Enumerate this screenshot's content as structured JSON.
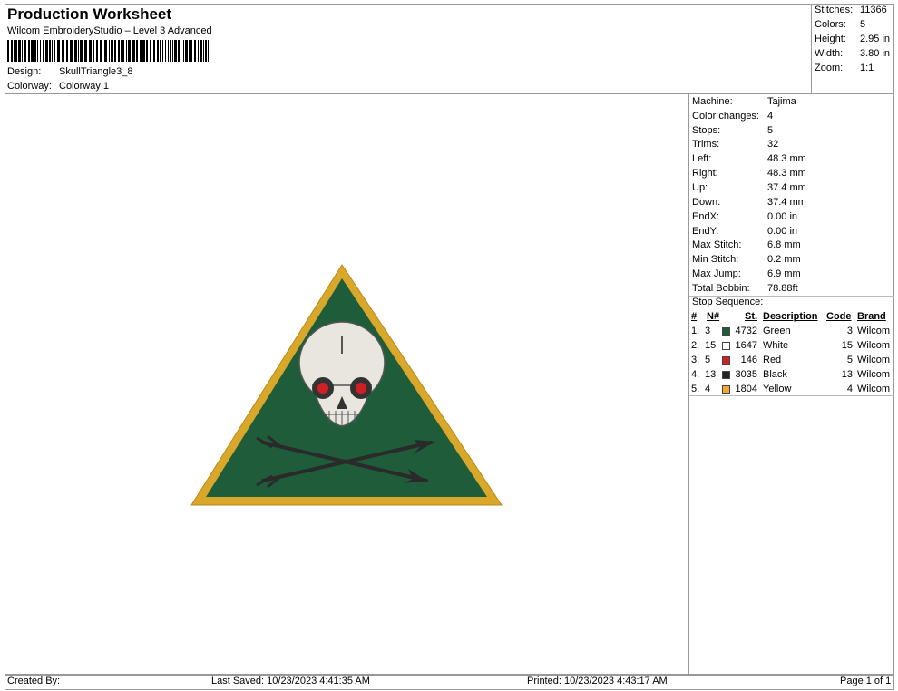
{
  "header": {
    "title": "Production Worksheet",
    "subtitle": "Wilcom EmbroideryStudio – Level 3 Advanced",
    "design_label": "Design:",
    "design_value": "SkullTriangle3_8",
    "colorway_label": "Colorway:",
    "colorway_value": "Colorway 1"
  },
  "stats": [
    {
      "label": "Stitches:",
      "value": "11366"
    },
    {
      "label": "Colors:",
      "value": "5"
    },
    {
      "label": "Height:",
      "value": "2.95 in"
    },
    {
      "label": "Width:",
      "value": "3.80 in"
    },
    {
      "label": "Zoom:",
      "value": "1:1"
    }
  ],
  "properties": [
    {
      "label": "Machine:",
      "value": "Tajima"
    },
    {
      "label": "Color changes:",
      "value": "4"
    },
    {
      "label": "Stops:",
      "value": "5"
    },
    {
      "label": "Trims:",
      "value": "32"
    },
    {
      "label": "Left:",
      "value": "48.3 mm"
    },
    {
      "label": "Right:",
      "value": "48.3 mm"
    },
    {
      "label": "Up:",
      "value": "37.4 mm"
    },
    {
      "label": "Down:",
      "value": "37.4 mm"
    },
    {
      "label": "EndX:",
      "value": "0.00 in"
    },
    {
      "label": "EndY:",
      "value": "0.00 in"
    },
    {
      "label": "Max Stitch:",
      "value": "6.8 mm"
    },
    {
      "label": "Min Stitch:",
      "value": "0.2 mm"
    },
    {
      "label": "Max Jump:",
      "value": "6.9 mm"
    },
    {
      "label": "Total Bobbin:",
      "value": "78.88ft"
    }
  ],
  "stop_sequence": {
    "title": "Stop Sequence:",
    "headers": {
      "num": "#",
      "n": "N#",
      "st": "St.",
      "description": "Description",
      "code": "Code",
      "brand": "Brand"
    },
    "rows": [
      {
        "num": "1.",
        "n": "3",
        "color": "#1e5c3a",
        "st": "4732",
        "description": "Green",
        "code": "3",
        "brand": "Wilcom"
      },
      {
        "num": "2.",
        "n": "15",
        "color": "#ffffff",
        "st": "1647",
        "description": "White",
        "code": "15",
        "brand": "Wilcom"
      },
      {
        "num": "3.",
        "n": "5",
        "color": "#d21f26",
        "st": "146",
        "description": "Red",
        "code": "5",
        "brand": "Wilcom"
      },
      {
        "num": "4.",
        "n": "13",
        "color": "#222222",
        "st": "3035",
        "description": "Black",
        "code": "13",
        "brand": "Wilcom"
      },
      {
        "num": "5.",
        "n": "4",
        "color": "#f0a830",
        "st": "1804",
        "description": "Yellow",
        "code": "4",
        "brand": "Wilcom"
      }
    ]
  },
  "footer": {
    "created_by": "Created By:",
    "last_saved": "Last Saved: 10/23/2023 4:41:35 AM",
    "printed": "Printed: 10/23/2023 4:43:17 AM",
    "page": "Page 1 of 1"
  },
  "colors": {
    "green": "#1e5c3a",
    "yellow": "#d9a82a",
    "white": "#e8e6de",
    "red": "#d21f26",
    "black": "#2a2a2a"
  }
}
